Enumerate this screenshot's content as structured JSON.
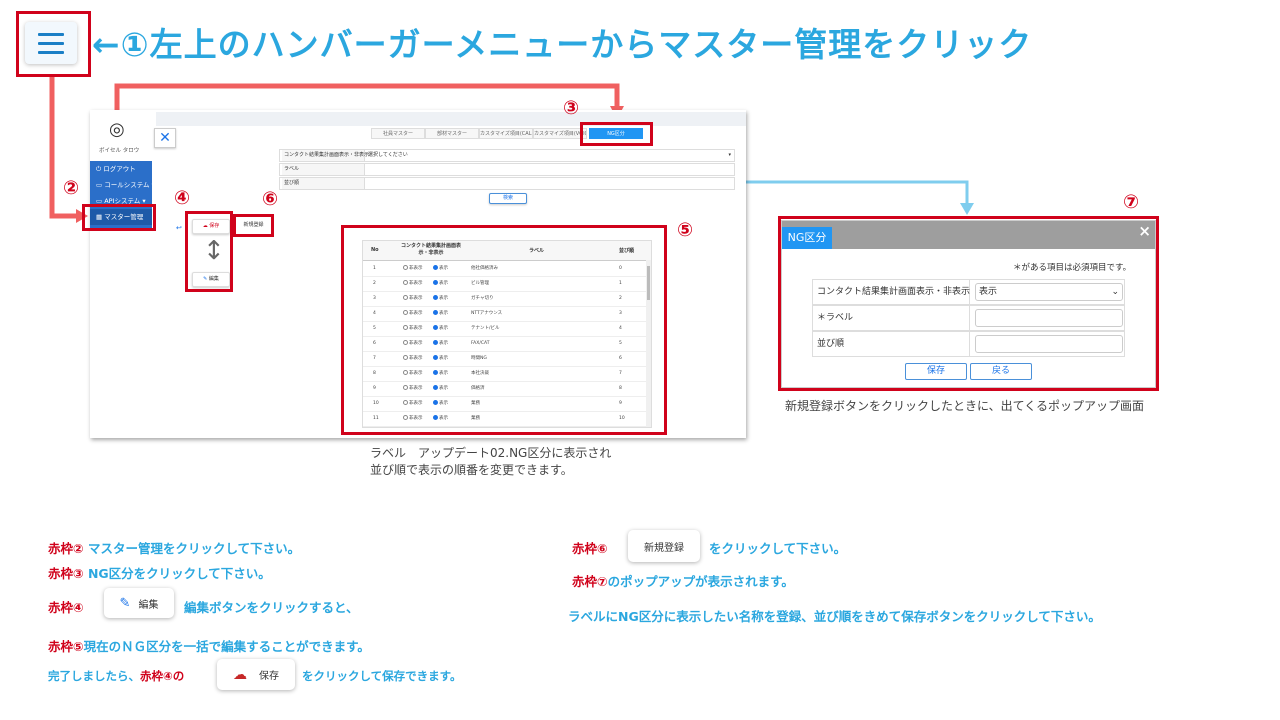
{
  "title": "←①左上のハンバーガーメニューからマスター管理をクリック",
  "numbers": {
    "n2": "②",
    "n3": "③",
    "n4": "④",
    "n5": "⑤",
    "n6": "⑥",
    "n7": "⑦"
  },
  "sidebar": {
    "user_name": "ボイセル タロウ",
    "menu": [
      "ログアウト",
      "コールシステム",
      "APIシステム",
      "マスター管理"
    ]
  },
  "tabs": [
    "社員マスター",
    "部材マスター",
    "カスタマイズ項目(CALL)",
    "カスタマイズ項目(VOICE)",
    "NG区分"
  ],
  "form": {
    "row1_label": "コンタクト結果集計画面表示・非表示",
    "row1_value": "選択してください",
    "row2_label": "ラベル",
    "row3_label": "並び順",
    "search_btn": "検索"
  },
  "buttons": {
    "save": "保存",
    "edit": "編集",
    "new": "新規登録"
  },
  "table": {
    "headers": [
      "No",
      "コンタクト結果集計画面表示・非表示",
      "ラベル",
      "並び順"
    ],
    "opt_hide": "非表示",
    "opt_show": "表示",
    "rows": [
      {
        "no": "1",
        "label": "他社価格済み",
        "order": "0"
      },
      {
        "no": "2",
        "label": "ビル管理",
        "order": "1"
      },
      {
        "no": "3",
        "label": "ガチャ切り",
        "order": "2"
      },
      {
        "no": "4",
        "label": "NTTアナウンス",
        "order": "3"
      },
      {
        "no": "5",
        "label": "テナント/ビル",
        "order": "4"
      },
      {
        "no": "6",
        "label": "FAX/CAT",
        "order": "5"
      },
      {
        "no": "7",
        "label": "時間NG",
        "order": "6"
      },
      {
        "no": "8",
        "label": "本社決裁",
        "order": "7"
      },
      {
        "no": "9",
        "label": "価格済",
        "order": "8"
      },
      {
        "no": "10",
        "label": "業務",
        "order": "9"
      },
      {
        "no": "11",
        "label": "業務",
        "order": "10"
      }
    ]
  },
  "popup": {
    "tab": "NG区分",
    "required_note": "＊がある項目は必須項目です。",
    "row1_label": "コンタクト結果集計画面表示・非表示",
    "row1_value": "表示",
    "row2_label": "＊ラベル",
    "row3_label": "並び順",
    "save": "保存",
    "back": "戻る",
    "caption": "新規登録ボタンをクリックしたときに、出てくるポップアップ画面"
  },
  "caption": {
    "line1": "ラベル　アップデート02.NG区分に表示され",
    "line2": "並び順で表示の順番を変更できます。"
  },
  "instructions": {
    "i1_red": "赤枠②",
    "i1": " マスター管理をクリックして下さい。",
    "i2_red": "赤枠③",
    "i2": " NG区分をクリックして下さい。",
    "i3_red": "赤枠④",
    "i3": "編集ボタンをクリックすると、",
    "i4_red": "赤枠⑤",
    "i4": "現在のＮＧ区分を一括で編集することができます。",
    "i5a": "完了しましたら、",
    "i5_red": "赤枠④の",
    "i5b": "をクリックして保存できます。",
    "i6_red": "赤枠⑥",
    "i6": "をクリックして下さい。",
    "i7_red": "赤枠⑦",
    "i7": "のポップアップが表示されます。",
    "i8": "ラベルにNG区分に表示したい名称を登録、並び順をきめて保存ボタンをクリックして下さい。"
  },
  "colors": {
    "accent": "#2ba7df",
    "red": "#d0021b",
    "blue": "#2196f3"
  }
}
